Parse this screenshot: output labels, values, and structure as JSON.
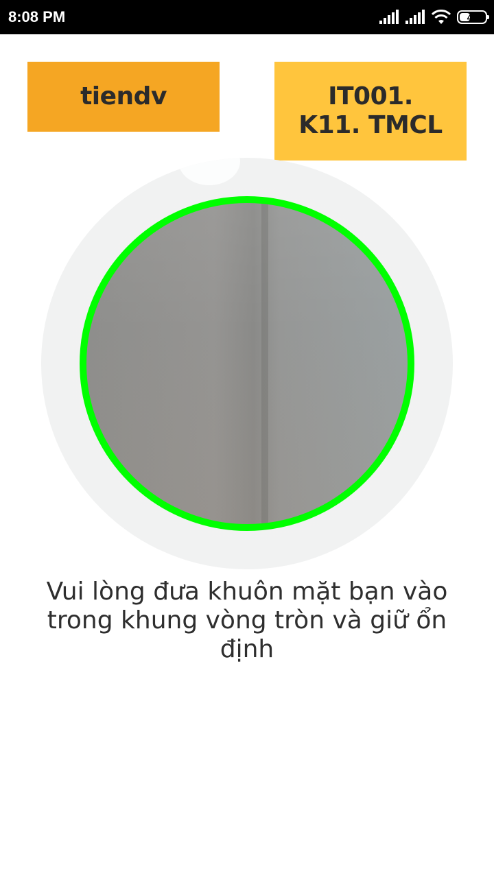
{
  "status_bar": {
    "time": "8:08 PM",
    "battery_level": "41",
    "battery_fraction": 0.41,
    "icons": [
      "signal-icon",
      "signal-icon",
      "wifi-icon",
      "battery-icon"
    ]
  },
  "user": {
    "name": "tiendv",
    "class_code": "IT001. K11. TMCL"
  },
  "camera": {
    "ring_color": "#00ff00"
  },
  "instruction": "Vui lòng đưa khuôn mặt bạn vào trong khung vòng tròn và giữ ổn định",
  "colors": {
    "name_box": "#f5a623",
    "class_box": "#ffc53d",
    "status_bar": "#000000"
  }
}
